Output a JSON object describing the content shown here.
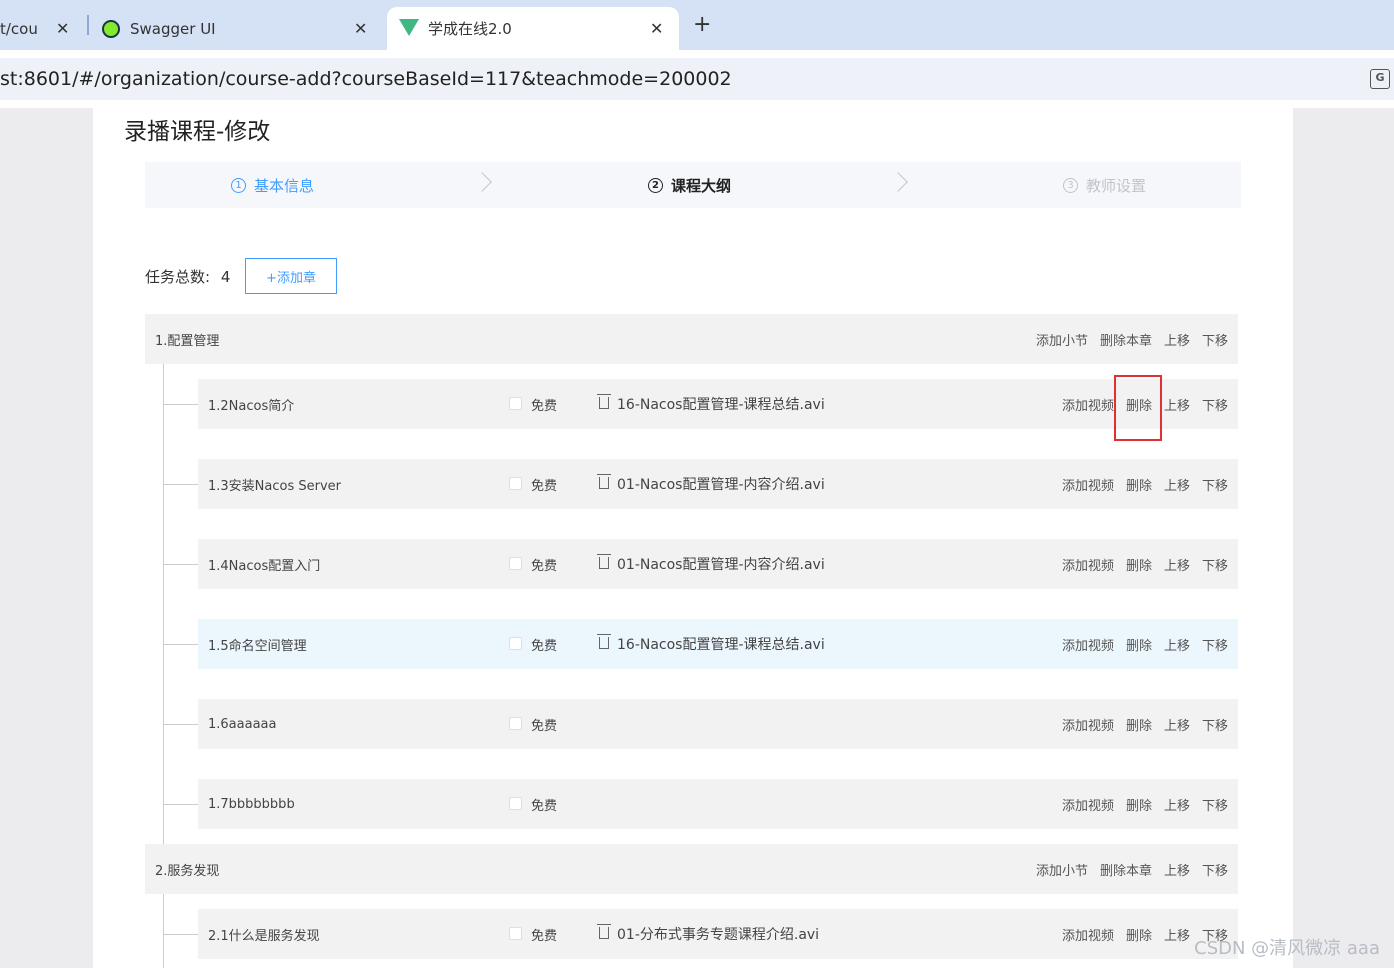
{
  "browser": {
    "tabs": [
      {
        "label": "t/cou",
        "active": false
      },
      {
        "label": "Swagger UI",
        "active": false
      },
      {
        "label": "学成在线2.0",
        "active": true
      }
    ],
    "close_glyph": "✕",
    "new_tab": "+",
    "url": "st:8601/#/organization/course-add?courseBaseId=117&teachmode=200002",
    "translate_icon": "G"
  },
  "page": {
    "title": "录播课程-修改",
    "steps": [
      {
        "num": "1",
        "label": "基本信息",
        "state": "done"
      },
      {
        "num": "2",
        "label": "课程大纲",
        "state": "active"
      },
      {
        "num": "3",
        "label": "教师设置",
        "state": "wait"
      }
    ],
    "total_label": "任务总数:",
    "total_value": "4",
    "add_chapter": "+添加章",
    "chapter_ops": [
      "添加小节",
      "删除本章",
      "上移",
      "下移"
    ],
    "section_ops": [
      "添加视频",
      "删除",
      "上移",
      "下移"
    ],
    "free_label": "免费",
    "chapters": [
      {
        "title": "1.配置管理",
        "sections": [
          {
            "title": "1.2Nacos简介",
            "video": "16-Nacos配置管理-课程总结.avi"
          },
          {
            "title": "1.3安装Nacos Server",
            "video": "01-Nacos配置管理-内容介绍.avi"
          },
          {
            "title": "1.4Nacos配置入门",
            "video": "01-Nacos配置管理-内容介绍.avi"
          },
          {
            "title": "1.5命名空间管理",
            "video": "16-Nacos配置管理-课程总结.avi"
          },
          {
            "title": "1.6aaaaaa",
            "video": ""
          },
          {
            "title": "1.7bbbbbbbb",
            "video": ""
          }
        ]
      },
      {
        "title": "2.服务发现",
        "sections": [
          {
            "title": "2.1什么是服务发现",
            "video": "01-分布式事务专题课程介绍.avi"
          }
        ]
      }
    ]
  },
  "watermark": "CSDN @清风微凉 aaa",
  "colors": {
    "accent": "#409eff",
    "highlight": "#e03131"
  }
}
